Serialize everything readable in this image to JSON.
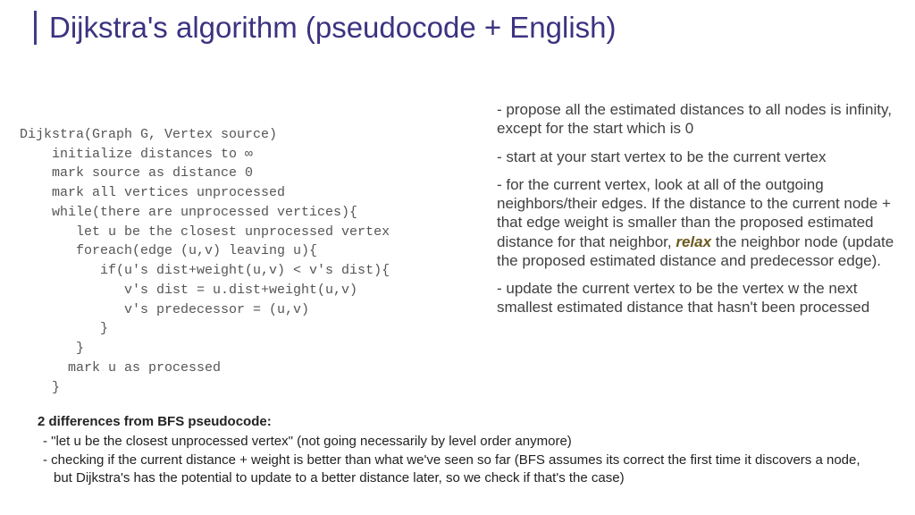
{
  "title": "Dijkstra's algorithm (pseudocode + English)",
  "pseudo": {
    "l0": "Dijkstra(Graph G, Vertex source)",
    "l1": "    initialize distances to ∞",
    "l2": "    mark source as distance 0",
    "l3": "    mark all vertices unprocessed",
    "l4": "    while(there are unprocessed vertices){",
    "l5": "       let u be the closest unprocessed vertex",
    "l6": "       foreach(edge (u,v) leaving u){",
    "l7": "          if(u's dist+weight(u,v) < v's dist){",
    "l8": "             v's dist = u.dist+weight(u,v)",
    "l9": "             v's predecessor = (u,v)",
    "l10": "          }",
    "l11": "       }",
    "l12": "      mark u as processed",
    "l13": "    }"
  },
  "english": {
    "p1": "- propose all the estimated distances to all nodes is infinity, except for the start which is 0",
    "p2": "- start at your start vertex to be the current vertex",
    "p3a": "   -  for the current vertex, look at all of the outgoing neighbors/their edges.  If the distance to the current node + that edge weight is smaller than the proposed estimated distance for that neighbor, ",
    "relax": "relax",
    "p3b": " the neighbor node (update the proposed estimated distance and predecessor edge).",
    "p4": "    - update the current vertex to be the vertex w the next smallest estimated distance that hasn't been processed"
  },
  "diffs": {
    "heading": "2 differences from BFS pseudocode:",
    "d1": "-   \"let u be the closest unprocessed vertex\" (not going necessarily by level order anymore)",
    "d2": "-   checking if the current distance + weight is better than what we've seen so far (BFS assumes its correct the first time it discovers a node, but Dijkstra's has the potential to update to a better distance later, so we check if that's the case)"
  }
}
